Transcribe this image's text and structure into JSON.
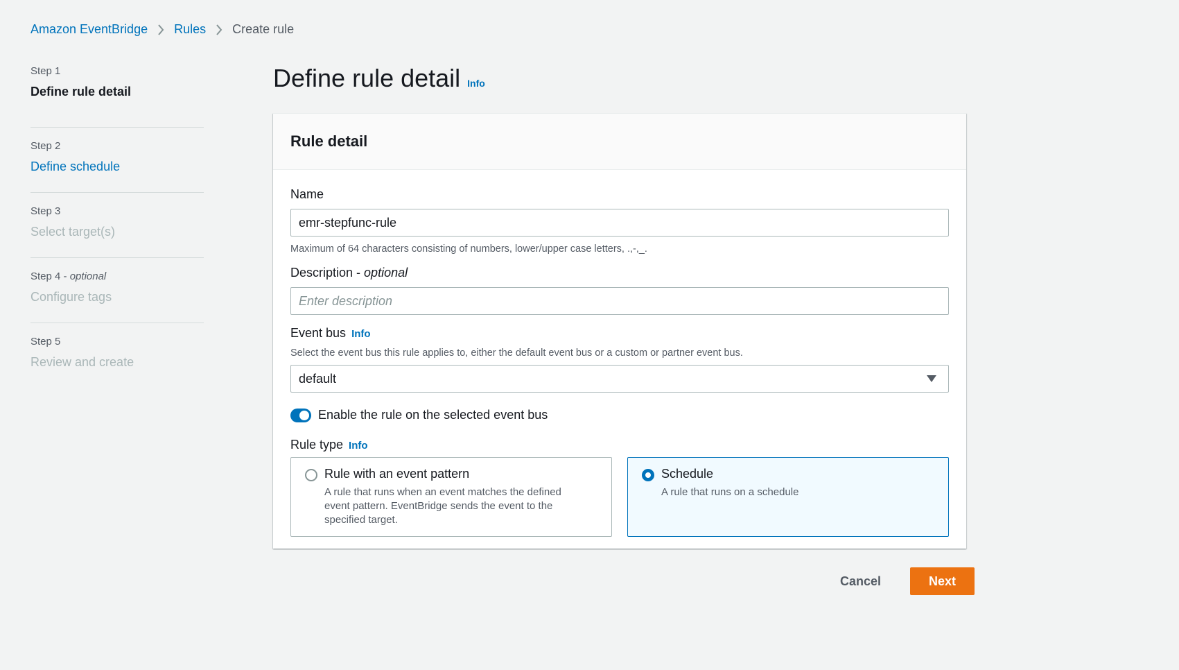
{
  "breadcrumb": {
    "items": [
      "Amazon EventBridge",
      "Rules"
    ],
    "current": "Create rule"
  },
  "steps": [
    {
      "num": "Step 1",
      "title": "Define rule detail",
      "state": "active"
    },
    {
      "num": "Step 2",
      "title": "Define schedule",
      "state": "link"
    },
    {
      "num": "Step 3",
      "title": "Select target(s)",
      "state": "disabled"
    },
    {
      "num": "Step 4",
      "optional": "optional",
      "title": "Configure tags",
      "state": "disabled"
    },
    {
      "num": "Step 5",
      "title": "Review and create",
      "state": "disabled"
    }
  ],
  "page": {
    "title": "Define rule detail",
    "info": "Info"
  },
  "panel": {
    "header": "Rule detail",
    "name": {
      "label": "Name",
      "value": "emr-stepfunc-rule",
      "hint": "Maximum of 64 characters consisting of numbers, lower/upper case letters, .,-,_."
    },
    "description": {
      "label": "Description -",
      "optional": "optional",
      "placeholder": "Enter description"
    },
    "event_bus": {
      "label": "Event bus",
      "info": "Info",
      "hint": "Select the event bus this rule applies to, either the default event bus or a custom or partner event bus.",
      "value": "default"
    },
    "toggle": {
      "label": "Enable the rule on the selected event bus",
      "checked": true
    },
    "rule_type": {
      "label": "Rule type",
      "info": "Info",
      "options": [
        {
          "title": "Rule with an event pattern",
          "desc": "A rule that runs when an event matches the defined event pattern. EventBridge sends the event to the specified target.",
          "selected": false
        },
        {
          "title": "Schedule",
          "desc": "A rule that runs on a schedule",
          "selected": true
        }
      ]
    }
  },
  "actions": {
    "cancel": "Cancel",
    "next": "Next"
  },
  "colors": {
    "primary": "#ec7211",
    "link": "#0073bb",
    "background": "#f2f3f3"
  }
}
